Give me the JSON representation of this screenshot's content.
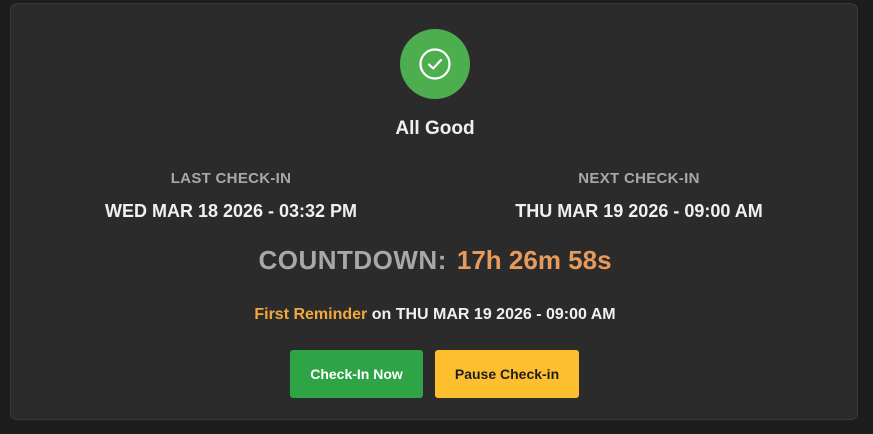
{
  "status": {
    "icon": "check-circle-icon",
    "text": "All Good",
    "color": "#4cae4f"
  },
  "last_checkin": {
    "label": "LAST CHECK-IN",
    "value": "WED MAR 18 2026 - 03:32 PM"
  },
  "next_checkin": {
    "label": "NEXT CHECK-IN",
    "value": "THU MAR 19 2026 - 09:00 AM"
  },
  "countdown": {
    "label": "COUNTDOWN:",
    "value": "17h 26m 58s",
    "value_color": "#e89a5a"
  },
  "reminder": {
    "name": "First Reminder",
    "rest": "on THU MAR 19 2026 - 09:00 AM",
    "name_color": "#f0a93a"
  },
  "buttons": {
    "checkin_label": "Check-In Now",
    "checkin_color": "#2ea447",
    "pause_label": "Pause Check-in",
    "pause_color": "#fdbf2d"
  }
}
